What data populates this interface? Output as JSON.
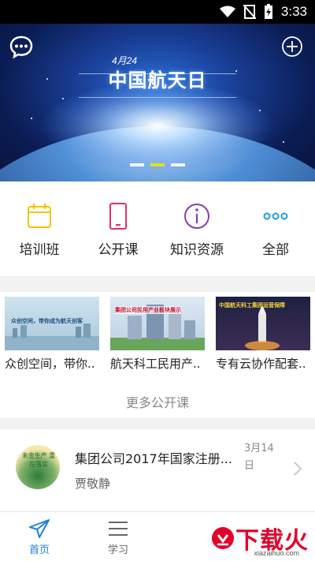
{
  "status_bar": {
    "time": "3:33",
    "icons": [
      "wifi-icon",
      "no-sim-icon",
      "battery-charging-icon"
    ]
  },
  "banner": {
    "date_text": "4月24",
    "title": "中国航天日",
    "icons": [
      "chat-bubble-icon",
      "plus-circle-icon"
    ],
    "active_slide": 2,
    "slide_count": 3
  },
  "quick_menu": [
    {
      "label": "培训班",
      "icon": "calendar-icon",
      "color": "#f2c400"
    },
    {
      "label": "公开课",
      "icon": "phone-icon",
      "color": "#e0306f"
    },
    {
      "label": "知识资源",
      "icon": "info-icon",
      "color": "#8a3bb0"
    },
    {
      "label": "全部",
      "icon": "more-dots-icon",
      "color": "#1aa0d8"
    }
  ],
  "courses": {
    "items": [
      {
        "title": "众创空间，带你..",
        "thumb_text": "众创空间，带你成为航天创客"
      },
      {
        "title": "航天科工民用产..",
        "thumb_text": "集团公司民用产业板块展示"
      },
      {
        "title": "专有云协作配套..",
        "thumb_text": "中国航天科工集团运营保障"
      }
    ],
    "more_label": "更多公开课"
  },
  "news": {
    "title": "集团公司2017年国家注册...",
    "author": "贾敬静",
    "date": "3月14日",
    "avatar_text": "未金生产 重在落实"
  },
  "tabbar": {
    "tabs": [
      {
        "label": "首页",
        "icon": "paper-plane-icon",
        "active": true
      },
      {
        "label": "学习",
        "icon": "menu-lines-icon",
        "active": false
      }
    ]
  },
  "watermark": {
    "text": "下载火",
    "sub": "xiazaihuo.com"
  },
  "colors": {
    "accent": "#1e7ee5",
    "watermark": "#e4002b"
  }
}
